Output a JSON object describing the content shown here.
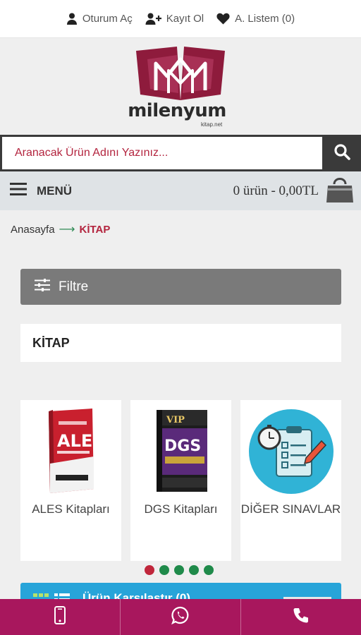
{
  "topbar": {
    "login_label": "Oturum Aç",
    "register_label": "Kayıt Ol",
    "wishlist_label": "A. Listem (0)"
  },
  "logo": {
    "name": "milenyum",
    "sub": "kitap.net",
    "brand_color": "#8e1b3c"
  },
  "search": {
    "placeholder": "Aranacak Ürün Adını Yazınız..."
  },
  "menu": {
    "label": "MENÜ",
    "cart_summary": "0 ürün - 0,00TL"
  },
  "breadcrumb": {
    "home": "Anasayfa",
    "arrow": "⟶",
    "current": "KİTAP"
  },
  "filter": {
    "label": "Filtre"
  },
  "category": {
    "title": "KİTAP",
    "cards": [
      {
        "label": "ALES Kitapları",
        "icon": "ales-book-cover"
      },
      {
        "label": "DGS Kitapları",
        "icon": "dgs-book-cover"
      },
      {
        "label": "DİĞER SINAVLAR",
        "icon": "exam-checklist-icon"
      }
    ]
  },
  "carousel": {
    "active_index": 0,
    "count": 5
  },
  "compare": {
    "label": "Ürün Karşılaştır (0)"
  },
  "colors": {
    "accent_red": "#b3243e",
    "bottom_bar": "#a8175d",
    "compare_blue": "#27a4d9",
    "dot_green": "#1f8a4a"
  }
}
